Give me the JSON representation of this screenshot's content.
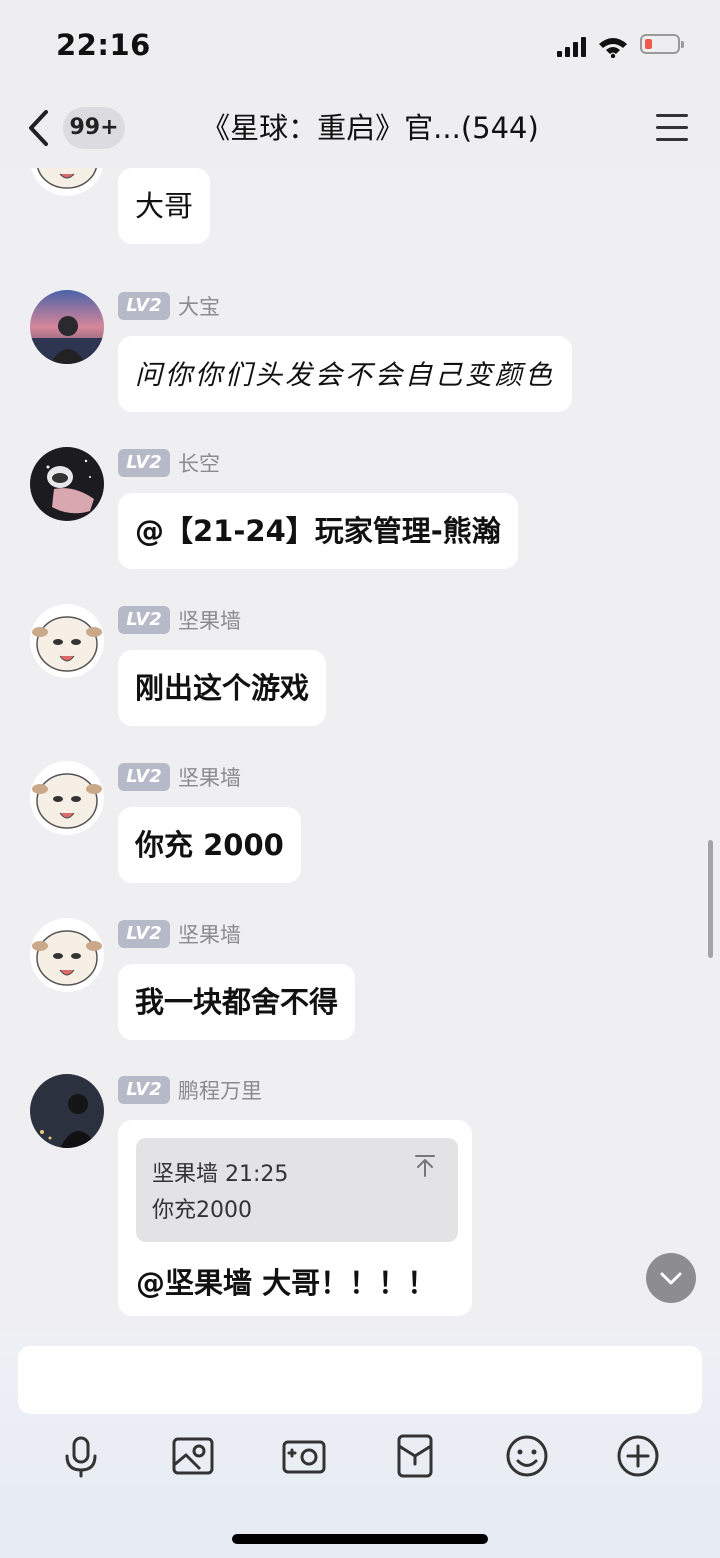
{
  "status_bar": {
    "time": "22:16"
  },
  "header": {
    "unread_badge": "99+",
    "title": "《星球：重启》官...(544)"
  },
  "messages": [
    {
      "text": "大哥"
    },
    {
      "level": "LV2",
      "nickname": "大宝",
      "text": "问你你们头发会不会自己变颜色"
    },
    {
      "level": "LV2",
      "nickname": "长空",
      "text": "@【21-24】玩家管理-熊瀚"
    },
    {
      "level": "LV2",
      "nickname": "坚果墙",
      "text": "刚出这个游戏"
    },
    {
      "level": "LV2",
      "nickname": "坚果墙",
      "text": "你充 2000"
    },
    {
      "level": "LV2",
      "nickname": "坚果墙",
      "text": "我一块都舍不得"
    },
    {
      "level": "LV2",
      "nickname": "鹏程万里",
      "quote_header": "坚果墙 21:25",
      "quote_text": "你充2000",
      "text": "@坚果墙 大哥！！！！"
    }
  ],
  "toolbar": {
    "icons": [
      "microphone-icon",
      "image-icon",
      "camera-icon",
      "red-packet-icon",
      "emoji-icon",
      "plus-icon"
    ]
  }
}
